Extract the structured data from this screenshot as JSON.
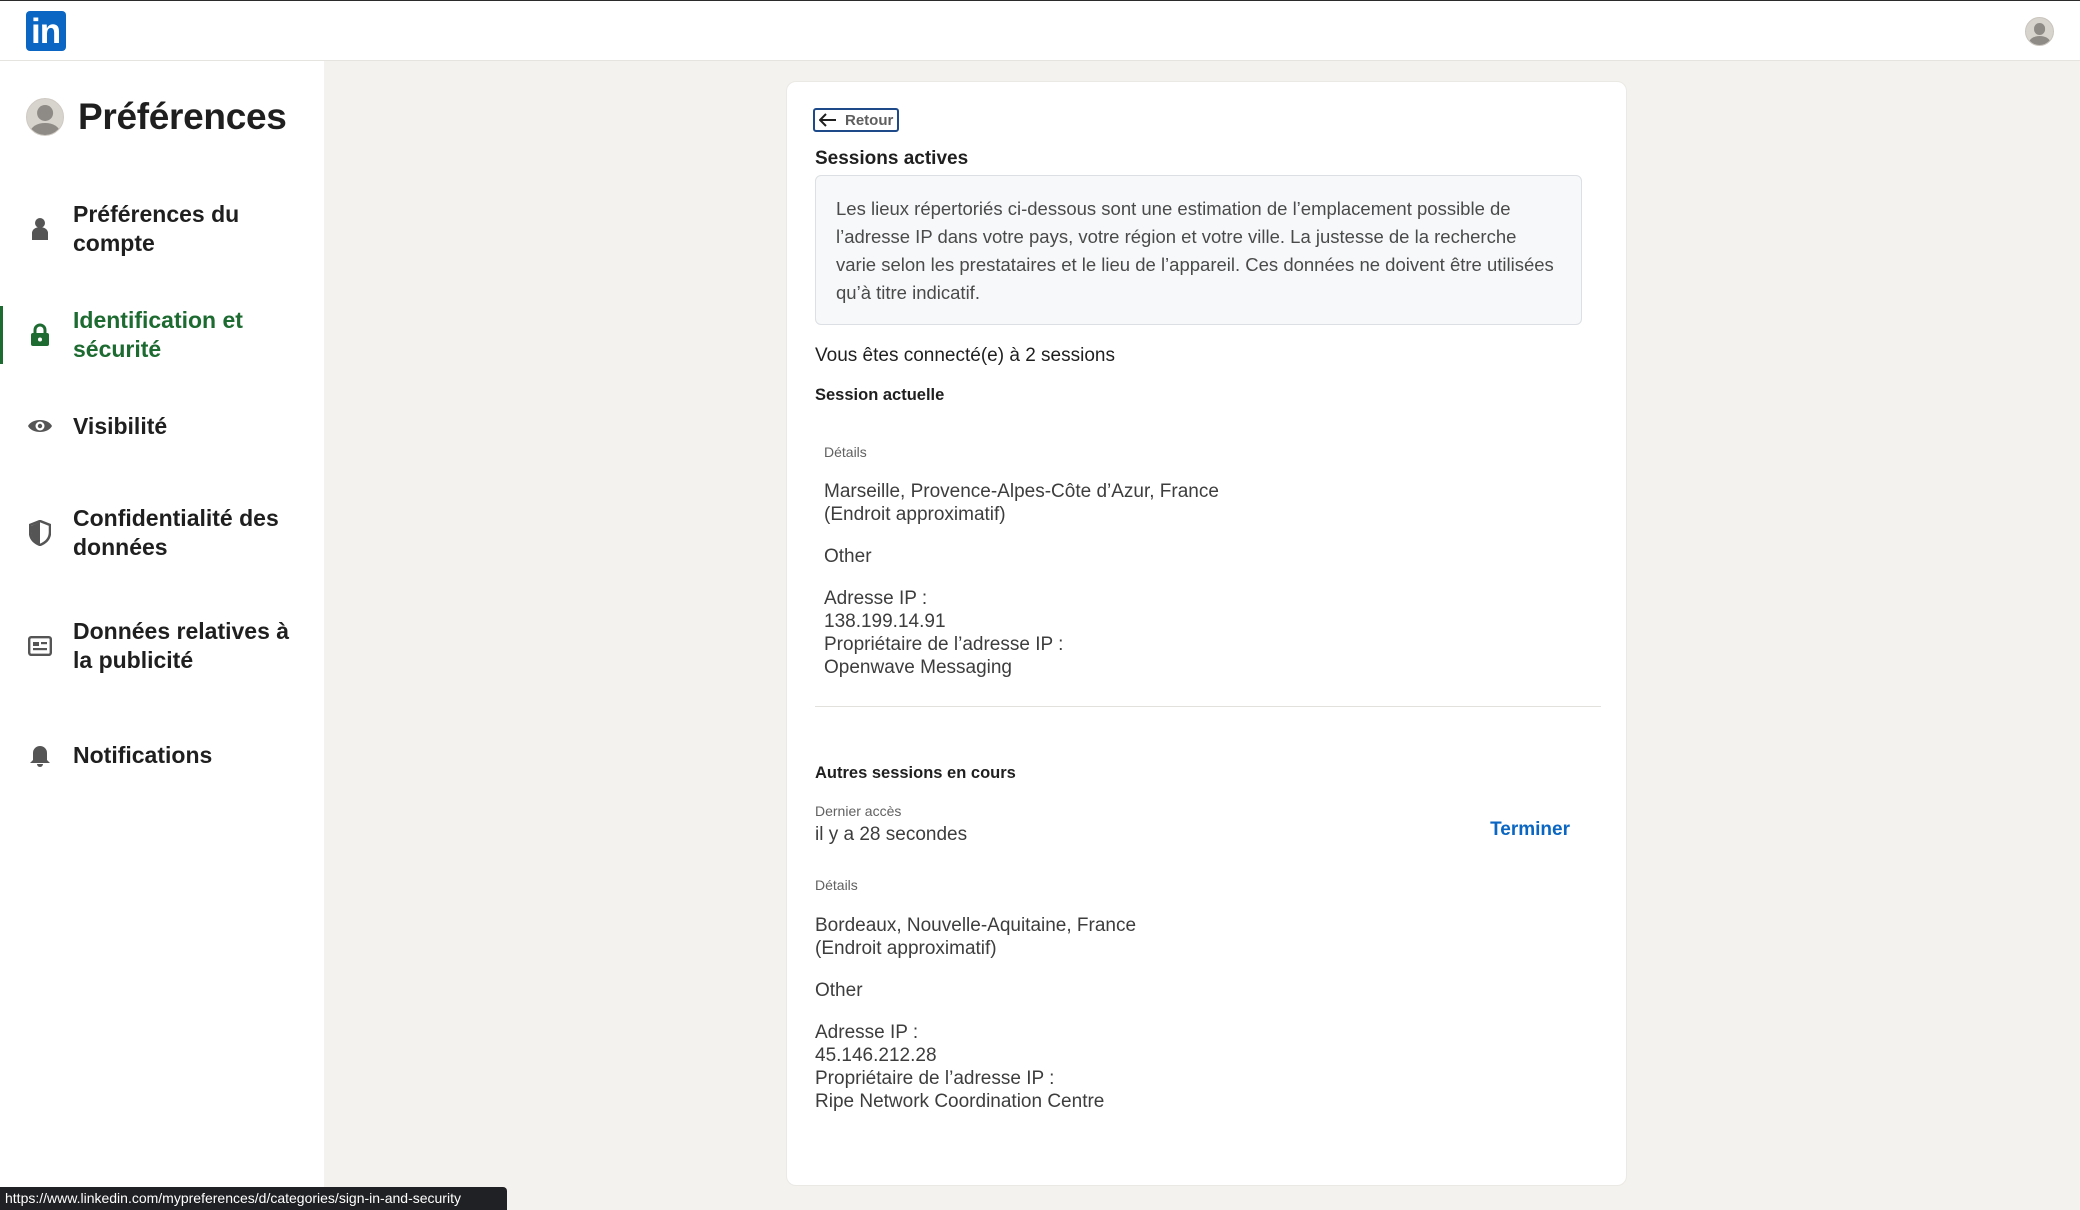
{
  "topbar": {
    "logo_text": "in",
    "logo_color": "#0a66c2"
  },
  "sidebar": {
    "title": "Préférences",
    "items": [
      {
        "label": "Préférences du compte",
        "icon": "person-icon",
        "active": false
      },
      {
        "label": "Identification et sécurité",
        "icon": "lock-icon",
        "active": true
      },
      {
        "label": "Visibilité",
        "icon": "eye-icon",
        "active": false
      },
      {
        "label": "Confidentialité des données",
        "icon": "shield-icon",
        "active": false
      },
      {
        "label": "Données relatives à la publicité",
        "icon": "ad-icon",
        "active": false
      },
      {
        "label": "Notifications",
        "icon": "bell-icon",
        "active": false
      }
    ],
    "active_color": "#1d6b31"
  },
  "main": {
    "back_label": "Retour",
    "section_title": "Sessions actives",
    "notice": "Les lieux répertoriés ci-dessous sont une estimation de l’emplacement possible de l’adresse IP dans votre pays, votre région et votre ville. La justesse de la recherche varie selon les prestataires et le lieu de l’appareil. Ces données ne doivent être utilisées qu’à titre indicatif.",
    "sessions_count": "Vous êtes connecté(e) à 2 sessions",
    "current": {
      "title": "Session actuelle",
      "details_label": "Détails",
      "location": "Marseille, Provence-Alpes-Côte d’Azur, France",
      "approx": "(Endroit approximatif)",
      "device": "Other",
      "ip_label": "Adresse IP :",
      "ip": "138.199.14.91",
      "owner_label": "Propriétaire de l’adresse IP :",
      "owner": "Openwave Messaging"
    },
    "other": {
      "title": "Autres sessions en cours",
      "last_access_label": "Dernier accès",
      "last_access": "il y a 28 secondes",
      "end_label": "Terminer",
      "details_label": "Détails",
      "location": "Bordeaux, Nouvelle-Aquitaine, France",
      "approx": "(Endroit approximatif)",
      "device": "Other",
      "ip_label": "Adresse IP :",
      "ip": "45.146.212.28",
      "owner_label": "Propriétaire de l’adresse IP :",
      "owner": "Ripe Network Coordination Centre"
    }
  },
  "statusbar": {
    "url": "https://www.linkedin.com/mypreferences/d/categories/sign-in-and-security"
  }
}
